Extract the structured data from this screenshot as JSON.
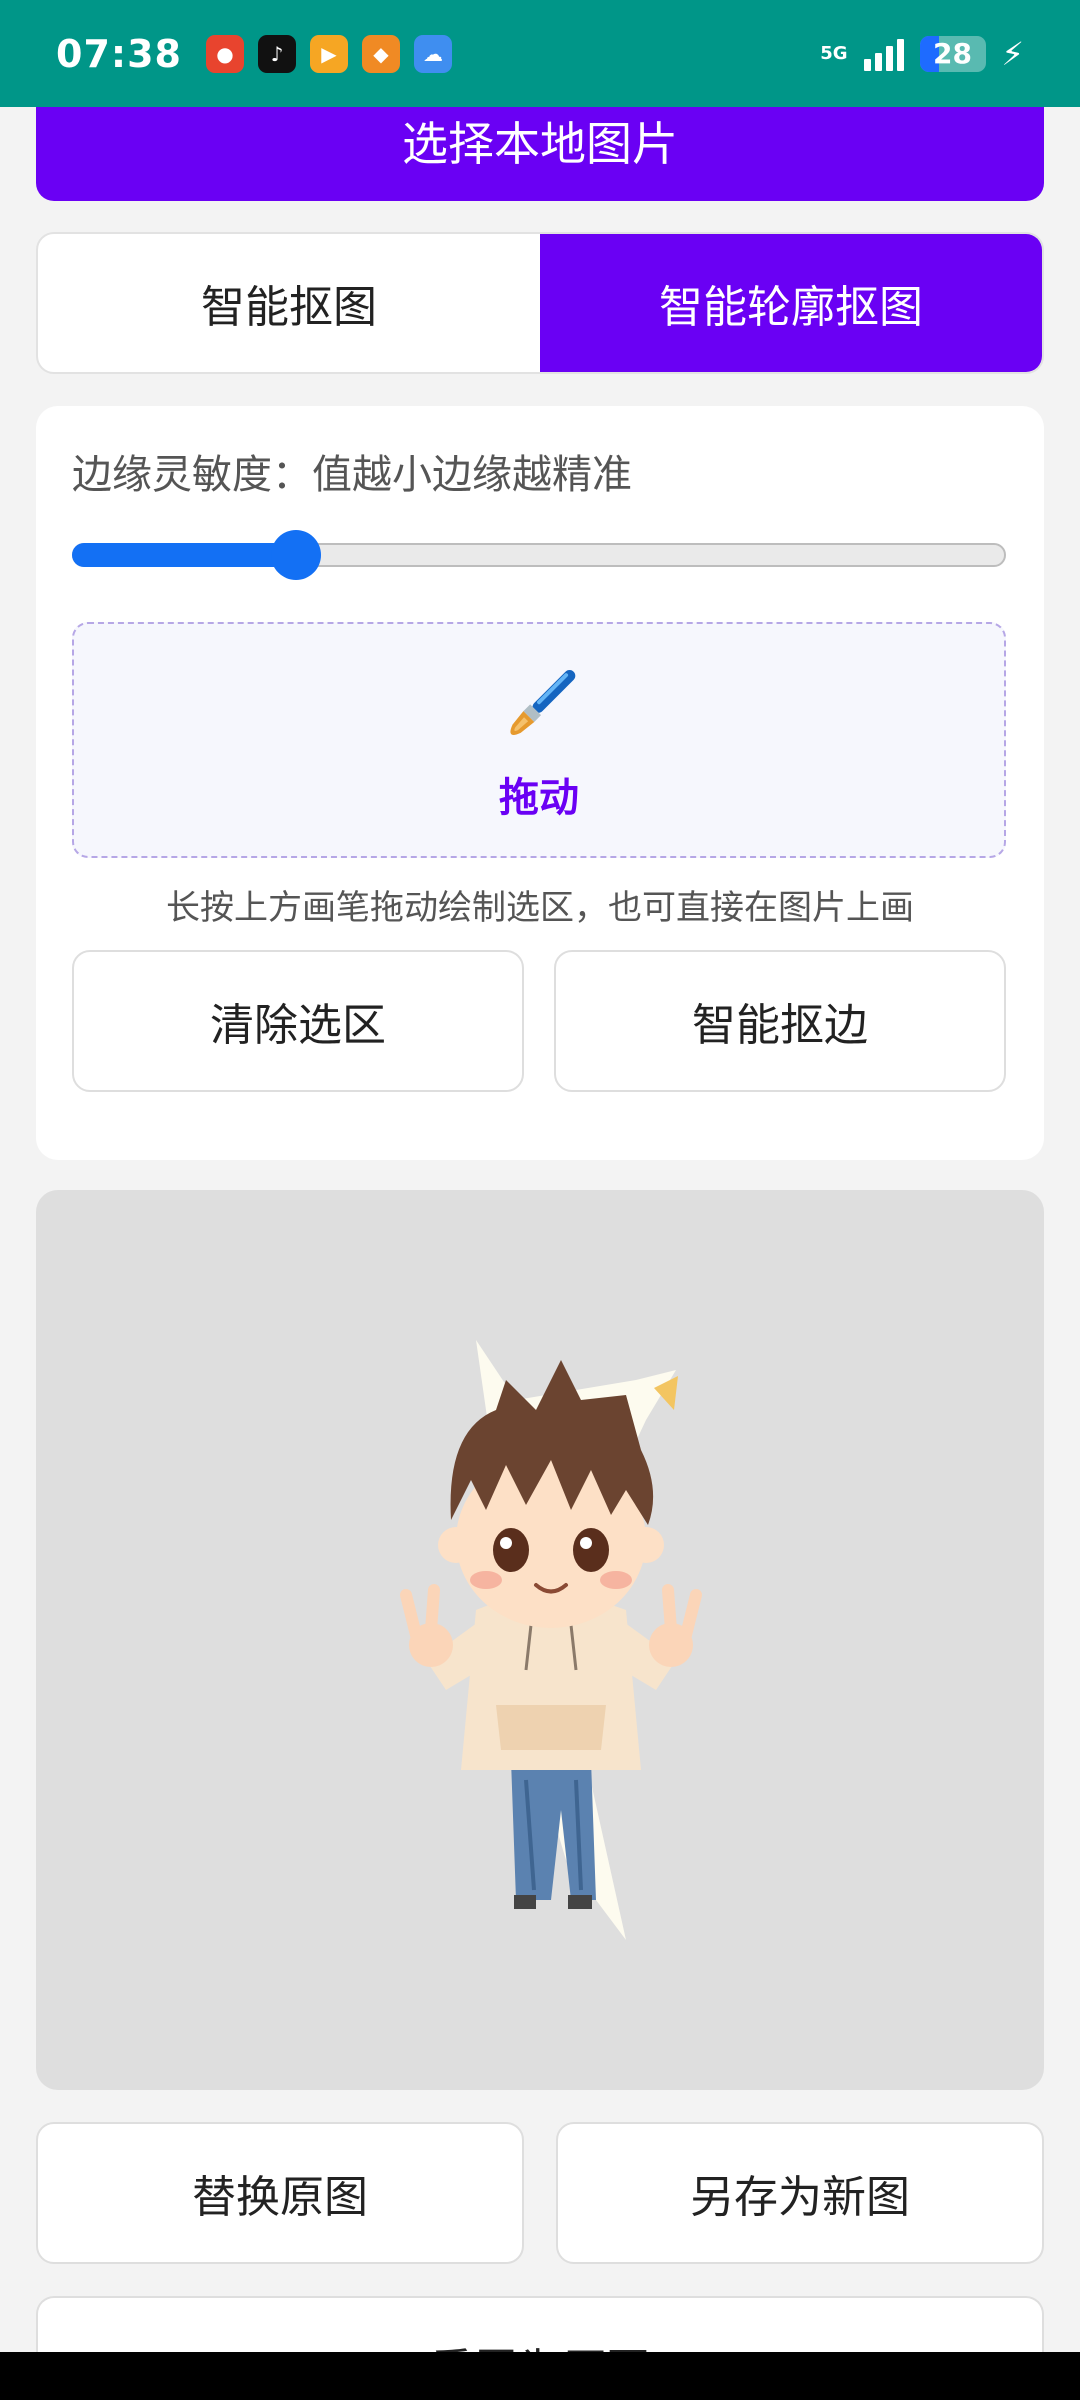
{
  "status_bar": {
    "time": "07:38",
    "network": "5G",
    "battery": "28",
    "notification_icons": [
      "app-red-icon",
      "tiktok-icon",
      "video-app-icon",
      "shop-app-icon",
      "weather-icon"
    ]
  },
  "top_button": {
    "label": "选择本地图片"
  },
  "tabs": [
    {
      "label": "智能抠图",
      "active": false
    },
    {
      "label": "智能轮廓抠图",
      "active": true
    }
  ],
  "sensitivity": {
    "label": "边缘灵敏度：值越小边缘越精准",
    "value_fraction": 0.24
  },
  "drag_area": {
    "icon": "paintbrush-icon",
    "label": "拖动"
  },
  "hint_text": "长按上方画笔拖动绘制选区，也可直接在图片上画",
  "card_buttons": {
    "clear": "清除选区",
    "smart_edge": "智能抠边"
  },
  "bottom_buttons": {
    "replace": "替换原图",
    "save_new": "另存为新图",
    "reset": "重置为原图"
  },
  "colors": {
    "status_bar": "#009688",
    "accent_purple": "#6a00f4",
    "slider_blue": "#1370f4"
  }
}
